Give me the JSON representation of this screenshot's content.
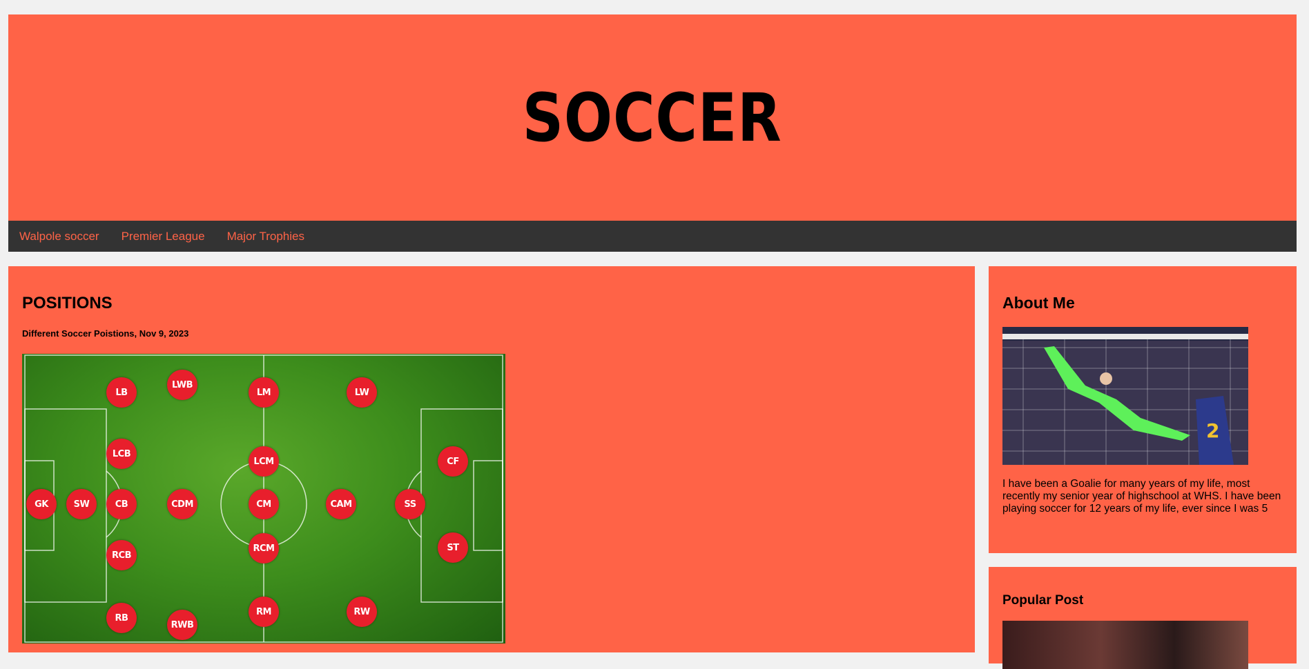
{
  "header": {
    "title": "SOCCER"
  },
  "nav": {
    "items": [
      "Walpole soccer",
      "Premier League",
      "Major Trophies"
    ]
  },
  "post": {
    "title": "POSITIONS",
    "subtitle": "Different Soccer Poistions, Nov 9, 2023",
    "positions": [
      "LB",
      "LWB",
      "LM",
      "LW",
      "LCB",
      "LCM",
      "CF",
      "GK",
      "SW",
      "CB",
      "CDM",
      "CM",
      "CAM",
      "SS",
      "RCB",
      "RCM",
      "ST",
      "RB",
      "RWB",
      "RM",
      "RW"
    ],
    "colors": {
      "marker": "#e81f2c",
      "marker_text": "#ffffff",
      "pitch": "#3d8d1c"
    }
  },
  "about": {
    "title": "About Me",
    "text": "I have been a Goalie for many years of my life, most recently my senior year of highschool at WHS. I have been playing soccer for 12 years of my life, ever since I was 5"
  },
  "popular": {
    "title": "Popular Post"
  },
  "colors": {
    "accent": "#ff6347",
    "nav_bg": "#333333",
    "page_bg": "#f1f1f1"
  }
}
